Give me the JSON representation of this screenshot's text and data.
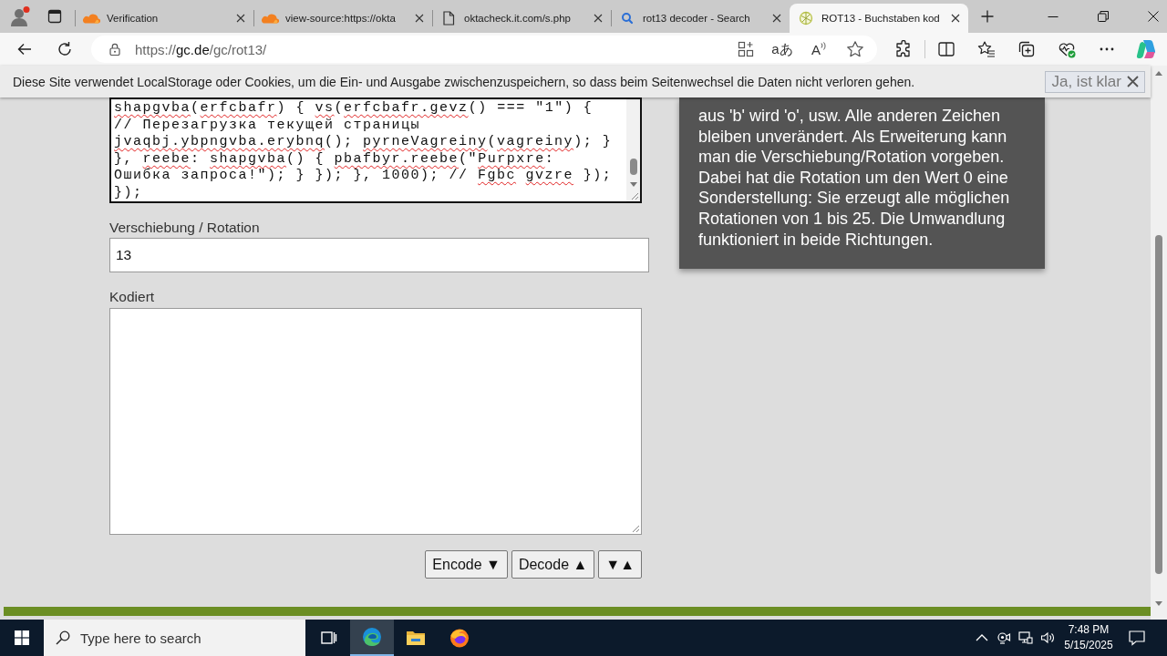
{
  "browser": {
    "tabs": [
      {
        "title": "Verification",
        "kind": "cloud",
        "selected": false
      },
      {
        "title": "view-source:https://okta",
        "kind": "cloud",
        "selected": false
      },
      {
        "title": "oktacheck.it.com/s.php",
        "kind": "page",
        "selected": false
      },
      {
        "title": "rot13 decoder - Search",
        "kind": "search",
        "selected": false
      },
      {
        "title": "ROT13 - Buchstaben kod",
        "kind": "site",
        "selected": true
      }
    ]
  },
  "address_bar": {
    "url": {
      "scheme": "https://",
      "host": "gc.de",
      "path": "/gc/rot13/"
    },
    "translate_label": "aあ",
    "read_aloud_label": "A"
  },
  "cookie_banner": {
    "text": "Diese Site verwendet LocalStorage oder Cookies, um die Ein- und Ausgabe zwischenzuspeichern, so dass beim Seitenwechsel die Daten nicht verloren gehen.",
    "button": "Ja, ist klar"
  },
  "code_input": {
    "lines": [
      {
        "parts": [
          {
            "text": "shapgvba",
            "misspelled": true
          },
          {
            "text": "(",
            "misspelled": false
          },
          {
            "text": "erfcbafr",
            "misspelled": true
          },
          {
            "text": ") { ",
            "misspelled": false
          },
          {
            "text": "vs",
            "misspelled": true
          },
          {
            "text": "(",
            "misspelled": false
          },
          {
            "text": "erfcbafr.gevz",
            "misspelled": true
          },
          {
            "text": "() === \"1\") {",
            "misspelled": false
          }
        ]
      },
      {
        "parts": [
          {
            "text": "// Перезагрузка текущей страницы",
            "misspelled": false
          }
        ]
      },
      {
        "parts": [
          {
            "text": "jvaqbj.ybpngvba.erybnq",
            "misspelled": true
          },
          {
            "text": "(); ",
            "misspelled": false
          },
          {
            "text": "pyrneVagreiny",
            "misspelled": true
          },
          {
            "text": "(",
            "misspelled": false
          },
          {
            "text": "vagreiny",
            "misspelled": true
          },
          {
            "text": "); }",
            "misspelled": false
          }
        ]
      },
      {
        "parts": [
          {
            "text": "}, ",
            "misspelled": false
          },
          {
            "text": "reebe",
            "misspelled": true
          },
          {
            "text": ": ",
            "misspelled": false
          },
          {
            "text": "shapgvba",
            "misspelled": true
          },
          {
            "text": "() { ",
            "misspelled": false
          },
          {
            "text": "pbafbyr.reebe",
            "misspelled": true
          },
          {
            "text": "(\"",
            "misspelled": false
          },
          {
            "text": "Purpxre",
            "misspelled": true
          },
          {
            "text": ":",
            "misspelled": false
          }
        ]
      },
      {
        "parts": [
          {
            "text": "Ошибка запроса!\"); } }); }, 1000); // ",
            "misspelled": false
          },
          {
            "text": "Fgbc",
            "misspelled": true
          },
          {
            "text": " gvzre",
            "misspelled": true
          },
          {
            "text": " });",
            "misspelled": false
          }
        ]
      },
      {
        "parts": [
          {
            "text": "});",
            "misspelled": false
          }
        ]
      }
    ]
  },
  "rotation": {
    "label": "Verschiebung / Rotation",
    "value": "13"
  },
  "encoded": {
    "label": "Kodiert"
  },
  "buttons": [
    {
      "label": "Encode ▼"
    },
    {
      "label": "Decode ▲"
    },
    {
      "label": "▼▲"
    }
  ],
  "info_box": {
    "text": "aus 'b' wird 'o', usw. Alle anderen Zeichen bleiben unverändert. Als Erweiterung kann man die Verschiebung/Rotation vorgeben. Dabei hat die Rotation um den Wert 0 eine Sonderstellung: Sie erzeugt alle möglichen Rotationen von 1 bis 25. Die Umwandlung funktioniert in beide Richtungen."
  },
  "taskbar": {
    "search_placeholder": "Type here to search",
    "apps": [
      {
        "kind": "task_view",
        "selected": false
      },
      {
        "kind": "edge",
        "selected": true
      },
      {
        "kind": "files",
        "selected": false
      },
      {
        "kind": "firefox",
        "selected": false
      }
    ],
    "time": "7:48 PM",
    "date": "5/15/2025"
  }
}
